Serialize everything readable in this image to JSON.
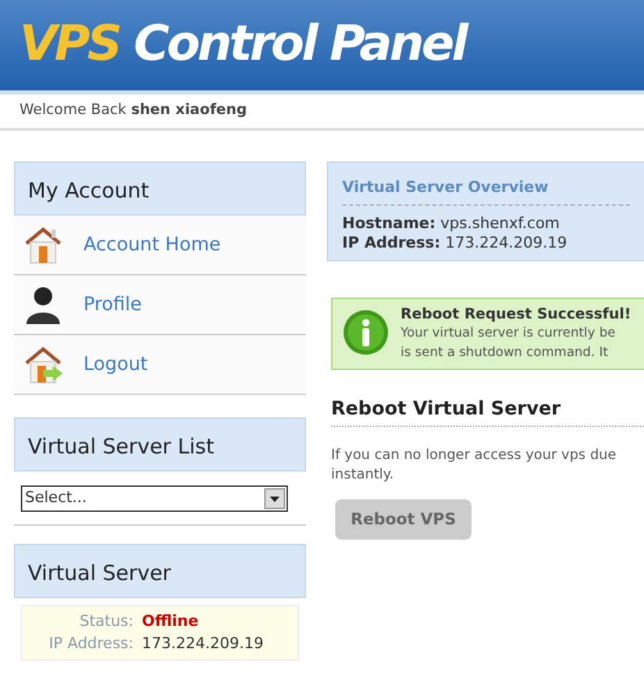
{
  "header": {
    "logo_accent": "VPS",
    "logo_rest": "Control Panel"
  },
  "welcome": {
    "prefix": "Welcome Back",
    "user": "shen xiaofeng"
  },
  "my_account": {
    "title": "My Account",
    "items": [
      {
        "label": "Account Home",
        "kind": "home"
      },
      {
        "label": "Profile",
        "kind": "person"
      },
      {
        "label": "Logout",
        "kind": "logout"
      }
    ]
  },
  "server_list": {
    "title": "Virtual Server List",
    "select": "Select..."
  },
  "virtual_server": {
    "title": "Virtual Server",
    "rows": [
      {
        "label": "Status:",
        "value": "Offline",
        "kind": "status"
      },
      {
        "label": "IP Address:",
        "value": "173.224.209.19",
        "kind": "plain"
      }
    ]
  },
  "overview": {
    "title": "Virtual Server Overview",
    "rows": [
      {
        "label": "Hostname:",
        "value": "vps.shenxf.com"
      },
      {
        "label": "IP Address:",
        "value": "173.224.209.19"
      }
    ]
  },
  "alert": {
    "title": "Reboot Request Successful!",
    "lines": [
      "Your virtual server is currently be",
      "is sent a shutdown command. It"
    ]
  },
  "reboot": {
    "title": "Reboot Virtual Server",
    "lines": [
      "If you can no longer access your vps due",
      "instantly."
    ],
    "button": "Reboot VPS",
    "disabled": true
  }
}
